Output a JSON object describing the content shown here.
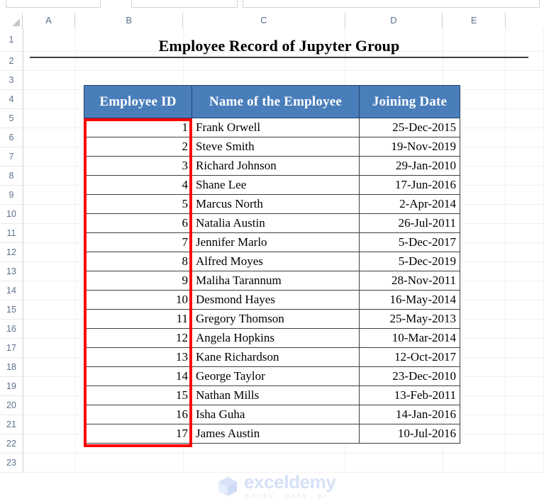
{
  "app": {
    "type": "spreadsheet",
    "column_headers": [
      "A",
      "B",
      "C",
      "D",
      "E",
      ""
    ],
    "row_headers": [
      "1",
      "2",
      "3",
      "4",
      "5",
      "6",
      "7",
      "8",
      "9",
      "10",
      "11",
      "12",
      "13",
      "14",
      "15",
      "16",
      "17",
      "18",
      "19",
      "20",
      "21",
      "22",
      "23"
    ]
  },
  "report": {
    "title": "Employee Record of Jupyter Group"
  },
  "table": {
    "headers": [
      "Employee ID",
      "Name of the Employee",
      "Joining Date"
    ],
    "header_fill": "#4a7ebb",
    "header_text_color": "#ffffff",
    "border_color": "#3f3f3f",
    "rows": [
      {
        "id": "1",
        "name": "Frank Orwell",
        "date": "25-Dec-2015"
      },
      {
        "id": "2",
        "name": "Steve Smith",
        "date": "19-Nov-2019"
      },
      {
        "id": "3",
        "name": "Richard Johnson",
        "date": "29-Jan-2010"
      },
      {
        "id": "4",
        "name": "Shane Lee",
        "date": "17-Jun-2016"
      },
      {
        "id": "5",
        "name": "Marcus North",
        "date": "2-Apr-2014"
      },
      {
        "id": "6",
        "name": "Natalia Austin",
        "date": "26-Jul-2011"
      },
      {
        "id": "7",
        "name": "Jennifer Marlo",
        "date": "5-Dec-2017"
      },
      {
        "id": "8",
        "name": "Alfred Moyes",
        "date": "5-Dec-2019"
      },
      {
        "id": "9",
        "name": "Maliha Tarannum",
        "date": "28-Nov-2011"
      },
      {
        "id": "10",
        "name": "Desmond Hayes",
        "date": "16-May-2014"
      },
      {
        "id": "11",
        "name": "Gregory Thomson",
        "date": "25-May-2013"
      },
      {
        "id": "12",
        "name": "Angela Hopkins",
        "date": "10-Mar-2014"
      },
      {
        "id": "13",
        "name": "Kane Richardson",
        "date": "12-Oct-2017"
      },
      {
        "id": "14",
        "name": "George Taylor",
        "date": "23-Dec-2010"
      },
      {
        "id": "15",
        "name": "Nathan Mills",
        "date": "13-Feb-2011"
      },
      {
        "id": "16",
        "name": "Isha Guha",
        "date": "14-Jan-2016"
      },
      {
        "id": "17",
        "name": "James Austin",
        "date": "10-Jul-2016"
      }
    ]
  },
  "annotation": {
    "highlight_color": "#ff0000",
    "highlight_target": "Employee ID column values"
  },
  "watermark": {
    "brand": "exceldemy",
    "tagline": "EXCEL · DATA · BI",
    "color": "#d6e1f7"
  }
}
